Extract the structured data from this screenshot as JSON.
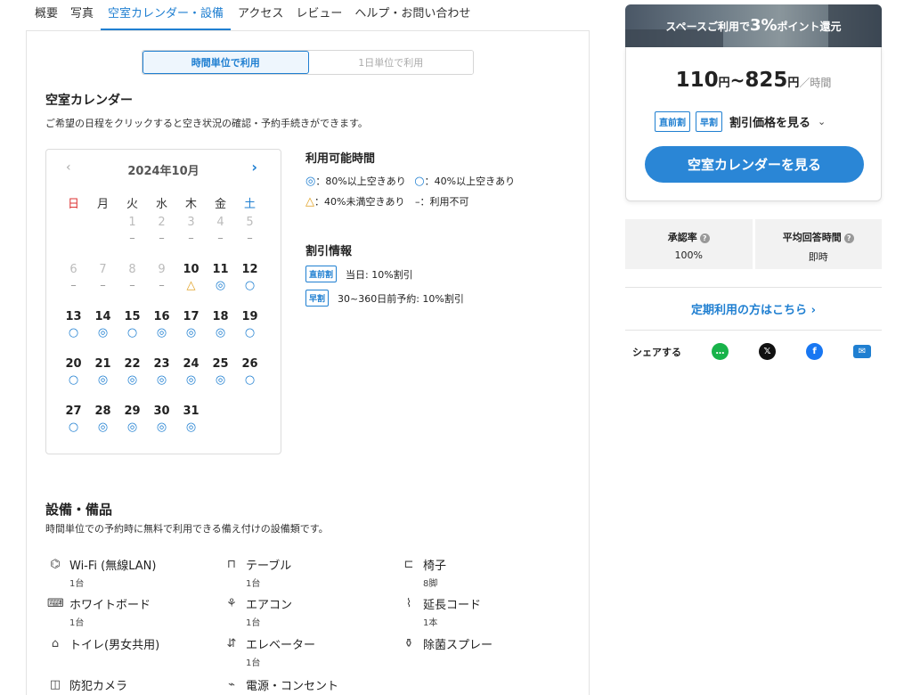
{
  "tabs": [
    {
      "label": "概要"
    },
    {
      "label": "写真"
    },
    {
      "label": "空室カレンダー・設備"
    },
    {
      "label": "アクセス"
    },
    {
      "label": "レビュー"
    },
    {
      "label": "ヘルプ・お問い合わせ"
    }
  ],
  "mode": {
    "hourly": "時間単位で利用",
    "daily": "1日単位で利用"
  },
  "calendar_section": {
    "title": "空室カレンダー",
    "desc": "ご希望の日程をクリックすると空き状況の確認・予約手続きができます。",
    "prev": "‹",
    "next": "›",
    "month": "2024年10月",
    "dow": [
      "日",
      "月",
      "火",
      "水",
      "木",
      "金",
      "土"
    ],
    "weeks": [
      [
        {
          "n": "",
          "m": ""
        },
        {
          "n": "",
          "m": ""
        },
        {
          "n": "1",
          "m": "–",
          "past": true
        },
        {
          "n": "2",
          "m": "–",
          "past": true
        },
        {
          "n": "3",
          "m": "–",
          "past": true
        },
        {
          "n": "4",
          "m": "–",
          "past": true
        },
        {
          "n": "5",
          "m": "–",
          "past": true
        }
      ],
      [
        {
          "n": "6",
          "m": "–",
          "past": true
        },
        {
          "n": "7",
          "m": "–",
          "past": true
        },
        {
          "n": "8",
          "m": "–",
          "past": true
        },
        {
          "n": "9",
          "m": "–",
          "past": true
        },
        {
          "n": "10",
          "m": "△"
        },
        {
          "n": "11",
          "m": "◎"
        },
        {
          "n": "12",
          "m": "○"
        }
      ],
      [
        {
          "n": "13",
          "m": "○"
        },
        {
          "n": "14",
          "m": "◎"
        },
        {
          "n": "15",
          "m": "○"
        },
        {
          "n": "16",
          "m": "◎"
        },
        {
          "n": "17",
          "m": "◎"
        },
        {
          "n": "18",
          "m": "◎"
        },
        {
          "n": "19",
          "m": "○"
        }
      ],
      [
        {
          "n": "20",
          "m": "○"
        },
        {
          "n": "21",
          "m": "◎"
        },
        {
          "n": "22",
          "m": "◎"
        },
        {
          "n": "23",
          "m": "◎"
        },
        {
          "n": "24",
          "m": "◎"
        },
        {
          "n": "25",
          "m": "◎"
        },
        {
          "n": "26",
          "m": "○"
        }
      ],
      [
        {
          "n": "27",
          "m": "○"
        },
        {
          "n": "28",
          "m": "◎"
        },
        {
          "n": "29",
          "m": "◎"
        },
        {
          "n": "30",
          "m": "◎"
        },
        {
          "n": "31",
          "m": "◎"
        },
        {
          "n": "",
          "m": ""
        },
        {
          "n": "",
          "m": ""
        }
      ]
    ]
  },
  "legend": {
    "title": "利用可能時間",
    "l1a_sym": "◎",
    "l1a": "：80%以上空きあり",
    "l1b_sym": "○",
    "l1b": "：40%以上空きあり",
    "l2a_sym": "△",
    "l2a": "：40%未満空きあり",
    "l2b_sym": "–",
    "l2b": "：利用不可"
  },
  "discount": {
    "title": "割引情報",
    "items": [
      {
        "badge": "直前割",
        "text": "当日: 10%割引"
      },
      {
        "badge": "早割",
        "text": "30~360日前予約: 10%割引"
      }
    ]
  },
  "equipment": {
    "title": "設備・備品",
    "desc": "時間単位での予約時に無料で利用できる備え付けの設備類です。",
    "items": [
      {
        "icon": "⌬",
        "name": "Wi-Fi (無線LAN)",
        "qty": "1台"
      },
      {
        "icon": "⊓",
        "name": "テーブル",
        "qty": "1台"
      },
      {
        "icon": "⊏",
        "name": "椅子",
        "qty": "8脚"
      },
      {
        "icon": "⌨",
        "name": "ホワイトボード",
        "qty": "1台"
      },
      {
        "icon": "⚘",
        "name": "エアコン",
        "qty": "1台"
      },
      {
        "icon": "⌇",
        "name": "延長コード",
        "qty": "1本"
      },
      {
        "icon": "⌂",
        "name": "トイレ(男女共用)",
        "qty": ""
      },
      {
        "icon": "⇵",
        "name": "エレベーター",
        "qty": "1台"
      },
      {
        "icon": "⚱",
        "name": "除菌スプレー",
        "qty": ""
      },
      {
        "icon": "◫",
        "name": "防犯カメラ",
        "qty": ""
      },
      {
        "icon": "⌁",
        "name": "電源・コンセント",
        "qty": ""
      }
    ]
  },
  "promo": {
    "pre": "スペースご利用で",
    "big": "3%",
    "post": "ポイント還元"
  },
  "price": {
    "min": "110",
    "yen1": "円",
    "sep": "~",
    "max": "825",
    "yen2": "円",
    "unit": "／時間"
  },
  "price_discounts": {
    "b1": "直前割",
    "b2": "早割",
    "see": "割引価格を見る",
    "chev": "⌄"
  },
  "cta": "空室カレンダーを見る",
  "stats": [
    {
      "label": "承認率",
      "help": "?",
      "value": "100%"
    },
    {
      "label": "平均回答時間",
      "help": "?",
      "value": "即時"
    }
  ],
  "regular_link": "定期利用の方はこちら ›",
  "share": {
    "label": "シェアする",
    "line": "…",
    "x": "𝕏",
    "fb": "f",
    "mail": "✉"
  },
  "colors": {
    "accent": "#1f7fd1",
    "cta": "#2a86d6",
    "sunday": "#dd3333",
    "triangle": "#e0a020",
    "line": "#18b34a",
    "facebook": "#1877f2"
  }
}
